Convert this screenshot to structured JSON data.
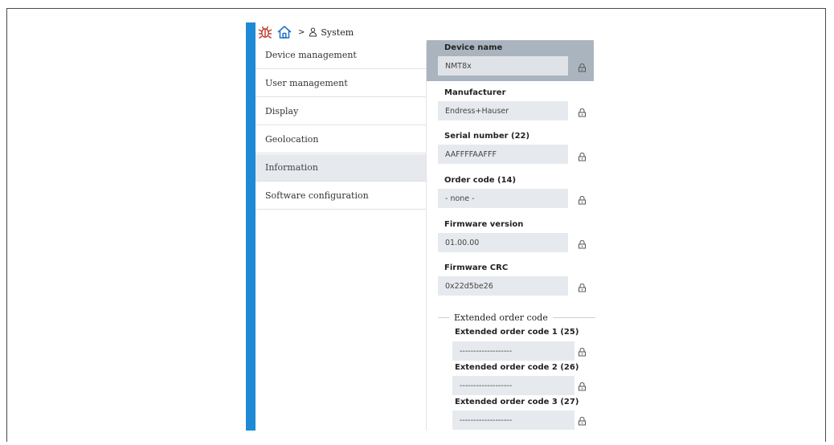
{
  "breadcrumb": {
    "icons": [
      "bug-icon",
      "home-icon",
      "person-icon"
    ],
    "separator": ">",
    "current": "System"
  },
  "nav": {
    "items": [
      {
        "label": "Device management"
      },
      {
        "label": "User management"
      },
      {
        "label": "Display"
      },
      {
        "label": "Geolocation"
      },
      {
        "label": "Information",
        "active": true
      },
      {
        "label": "Software configuration"
      }
    ]
  },
  "fields": {
    "device_name": {
      "label": "Device name",
      "value": "NMT8x"
    },
    "manufacturer": {
      "label": "Manufacturer",
      "value": "Endress+Hauser"
    },
    "serial_number": {
      "label": "Serial number (22)",
      "value": "AAFFFFAAFFF"
    },
    "order_code": {
      "label": "Order code (14)",
      "value": "- none -"
    },
    "firmware_version": {
      "label": "Firmware version",
      "value": "01.00.00"
    },
    "firmware_crc": {
      "label": "Firmware CRC",
      "value": "0x22d5be26"
    }
  },
  "extended": {
    "legend": "Extended order code",
    "code1": {
      "label": "Extended order code 1 (25)",
      "value": "-------------------"
    },
    "code2": {
      "label": "Extended order code 2 (26)",
      "value": "-------------------"
    },
    "code3": {
      "label": "Extended order code 3 (27)",
      "value": "-------------------"
    }
  },
  "colors": {
    "accent": "#1e8ad6",
    "field_bg": "#e6e9ee",
    "header_bg": "#aab4bf",
    "bug_icon": "#c0392b",
    "home_icon": "#1e6fc7"
  },
  "icons": {
    "lock": "lock-icon"
  }
}
